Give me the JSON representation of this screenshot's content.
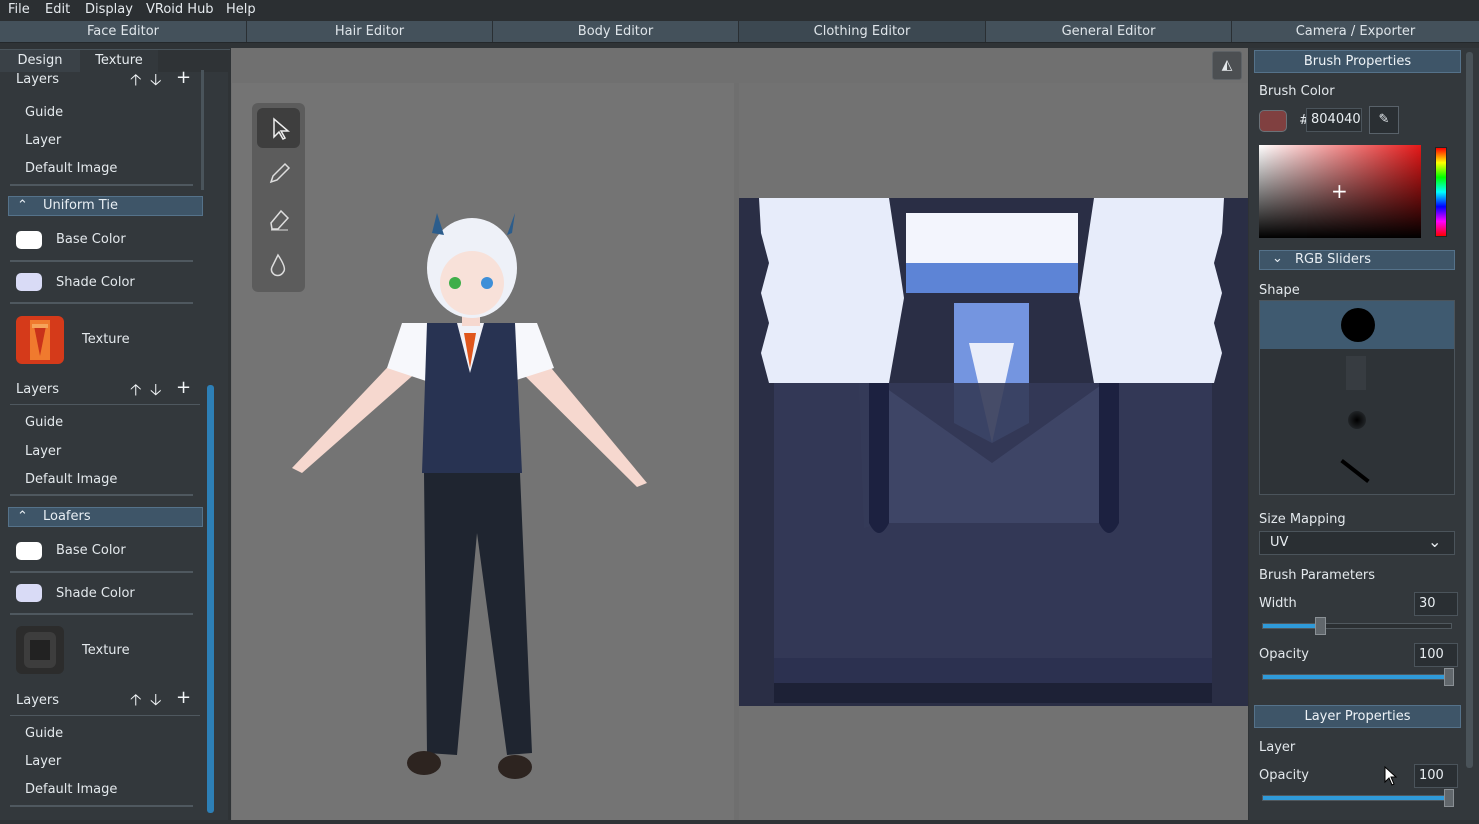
{
  "menu": [
    "File",
    "Edit",
    "Display",
    "VRoid Hub",
    "Help"
  ],
  "editor_tabs": [
    "Face Editor",
    "Hair Editor",
    "Body Editor",
    "Clothing Editor",
    "General Editor",
    "Camera / Exporter"
  ],
  "side_tabs": [
    "Design",
    "Texture"
  ],
  "left": {
    "top_layers": {
      "title": "Layers",
      "items": [
        "Guide",
        "Layer",
        "Default Image"
      ]
    },
    "uniform_tie": {
      "title": "Uniform Tie",
      "base": "Base Color",
      "shade": "Shade Color",
      "texture": "Texture",
      "layers_title": "Layers",
      "layers": [
        "Guide",
        "Layer",
        "Default Image"
      ]
    },
    "loafers": {
      "title": "Loafers",
      "base": "Base Color",
      "shade": "Shade Color",
      "texture": "Texture",
      "layers_title": "Layers",
      "layers": [
        "Guide",
        "Layer",
        "Default Image"
      ]
    }
  },
  "right": {
    "brush_header": "Brush Properties",
    "brush_color_label": "Brush Color",
    "hex_prefix": "#",
    "hex_value": "804040",
    "brush_color": "#804040",
    "rgb_sliders": "RGB Sliders",
    "shape_label": "Shape",
    "size_mapping_label": "Size Mapping",
    "size_mapping_value": "UV",
    "brush_params_label": "Brush Parameters",
    "width_label": "Width",
    "width_value": "30",
    "width_level": 30,
    "opacity_label": "Opacity",
    "opacity_value": "100",
    "opacity_level": 100,
    "layer_header": "Layer Properties",
    "layer_label": "Layer",
    "layer_opacity_label": "Opacity",
    "layer_opacity_value": "100",
    "layer_opacity_level": 100
  },
  "colors": {
    "accent": "#2f9ad9",
    "header": "#3e5568"
  }
}
